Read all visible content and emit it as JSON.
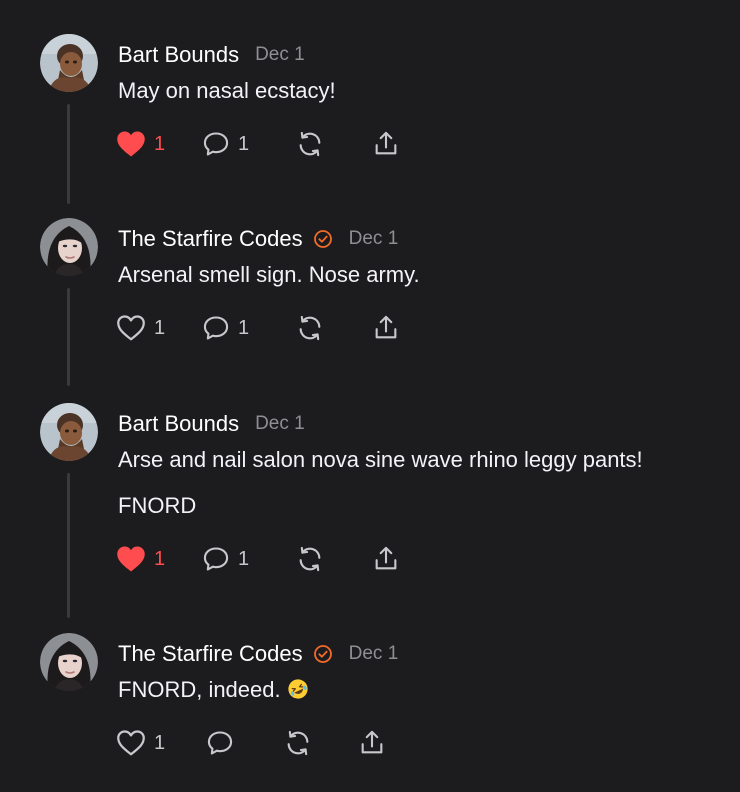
{
  "colors": {
    "background": "#1c1c1e",
    "like_active": "#ff4d4f",
    "verified_badge": "#f26b2a",
    "muted_text": "#8e8e93",
    "thread_line": "#3a3a3c"
  },
  "comments": [
    {
      "author": "Bart Bounds",
      "verified": false,
      "date": "Dec 1",
      "paragraphs": [
        "May on nasal ecstacy!"
      ],
      "likes": "1",
      "liked": true,
      "replies": "1",
      "avatar_icon": "caveman-avatar"
    },
    {
      "author": "The Starfire Codes",
      "verified": true,
      "date": "Dec 1",
      "paragraphs": [
        "Arsenal smell sign. Nose army."
      ],
      "likes": "1",
      "liked": false,
      "replies": "1",
      "avatar_icon": "woman-avatar"
    },
    {
      "author": "Bart Bounds",
      "verified": false,
      "date": "Dec 1",
      "paragraphs": [
        "Arse and nail salon nova sine wave rhino leggy pants!",
        "FNORD"
      ],
      "likes": "1",
      "liked": true,
      "replies": "1",
      "avatar_icon": "caveman-avatar"
    },
    {
      "author": "The Starfire Codes",
      "verified": true,
      "date": "Dec 1",
      "paragraphs": [
        "FNORD, indeed."
      ],
      "emoji": "rolling-on-floor-laughing-emoji",
      "likes": "1",
      "liked": false,
      "replies": "",
      "avatar_icon": "woman-avatar"
    }
  ]
}
